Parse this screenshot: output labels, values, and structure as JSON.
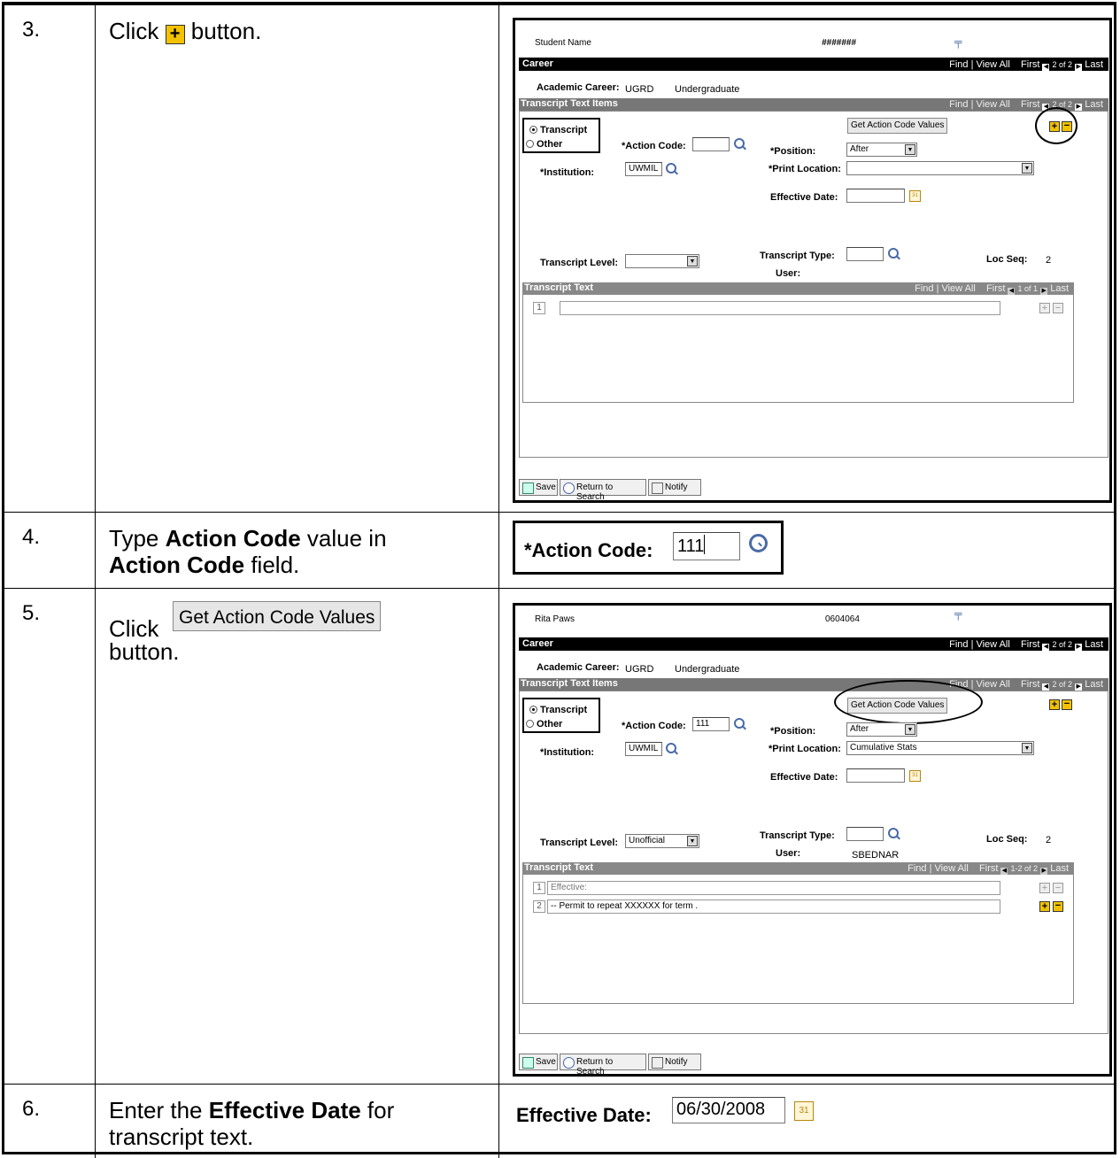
{
  "steps": [
    {
      "num": "3.",
      "pre": "Click ",
      "post": " button."
    },
    {
      "num": "4.",
      "t1": "Type ",
      "b1": "Action Code",
      "t2": " value in ",
      "b2": "Action Code",
      "t3": " field."
    },
    {
      "num": "5.",
      "pre": "Click ",
      "post": "button."
    },
    {
      "num": "6.",
      "t1": "Enter the ",
      "b1": "Effective Date",
      "t2": " for transcript text."
    }
  ],
  "inline_button_label": "Get Action Code Values",
  "shot1": {
    "student_name": "Student Name",
    "student_id": "#######",
    "career_title": "Career",
    "nav": "Find | View All",
    "nav_first": "First",
    "nav_count": "2 of 2",
    "nav_last": "Last",
    "academic_career_label": "Academic Career:",
    "academic_career_code": "UGRD",
    "academic_career_desc": "Undergraduate",
    "items_title": "Transcript Text Items",
    "items_count": "2 of 2",
    "radio_transcript": "Transcript",
    "radio_other": "Other",
    "get_button": "Get Action Code Values",
    "action_code_label": "*Action Code:",
    "action_code_value": "",
    "position_label": "*Position:",
    "position_value": "After",
    "institution_label": "*Institution:",
    "institution_value": "UWMIL",
    "print_location_label": "*Print Location:",
    "print_location_value": "",
    "effective_date_label": "Effective Date:",
    "transcript_type_label": "Transcript Type:",
    "loc_seq_label": "Loc Seq:",
    "loc_seq_value": "2",
    "transcript_level_label": "Transcript Level:",
    "transcript_level_value": "",
    "user_label": "User:",
    "user_value": "",
    "text_title": "Transcript Text",
    "text_count": "1 of 1",
    "rows": [
      {
        "idx": "1",
        "text": ""
      }
    ],
    "save": "Save",
    "return": "Return to Search",
    "notify": "Notify"
  },
  "shot2": {
    "action_code_label": "*Action Code:",
    "action_code_value": "111"
  },
  "shot3": {
    "student_name": "Rita Paws",
    "student_id": "0604064",
    "career_title": "Career",
    "nav": "Find | View All",
    "nav_first": "First",
    "nav_count": "2 of 2",
    "nav_last": "Last",
    "items_nav": "Find | View All",
    "academic_career_label": "Academic Career:",
    "academic_career_code": "UGRD",
    "academic_career_desc": "Undergraduate",
    "items_title": "Transcript Text Items",
    "items_count": "2 of 2",
    "radio_transcript": "Transcript",
    "radio_other": "Other",
    "get_button": "Get Action Code Values",
    "action_code_label": "*Action Code:",
    "action_code_value": "111",
    "position_label": "*Position:",
    "position_value": "After",
    "institution_label": "*Institution:",
    "institution_value": "UWMIL",
    "print_location_label": "*Print Location:",
    "print_location_value": "Cumulative Stats",
    "effective_date_label": "Effective Date:",
    "transcript_type_label": "Transcript Type:",
    "loc_seq_label": "Loc Seq:",
    "loc_seq_value": "2",
    "transcript_level_label": "Transcript Level:",
    "transcript_level_value": "Unofficial",
    "user_label": "User:",
    "user_value": "SBEDNAR",
    "text_title": "Transcript Text",
    "text_count": "1-2 of 2",
    "rows": [
      {
        "idx": "1",
        "text": "Effective:"
      },
      {
        "idx": "2",
        "text": "-- Permit to repeat XXXXXX for term          ."
      }
    ],
    "save": "Save",
    "return": "Return to Search",
    "notify": "Notify"
  },
  "shot4": {
    "effective_date_label": "Effective Date:",
    "effective_date_value": "06/30/2008"
  }
}
